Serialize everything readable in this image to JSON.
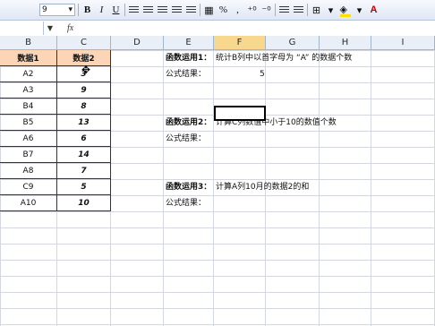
{
  "toolbar": {
    "font_size": "9",
    "bold": "B",
    "italic": "I",
    "underline": "U",
    "percent": "%",
    "comma": ",",
    "font_color": "A"
  },
  "formula_bar": {
    "fx": "fx"
  },
  "columns": [
    "B",
    "C",
    "D",
    "E",
    "F",
    "G",
    "H",
    "I"
  ],
  "active_column": "F",
  "table": {
    "headers": [
      "数据1",
      "数据2"
    ],
    "rows": [
      [
        "A2",
        "3"
      ],
      [
        "A3",
        "9"
      ],
      [
        "B4",
        "8"
      ],
      [
        "B5",
        "13"
      ],
      [
        "A6",
        "6"
      ],
      [
        "B7",
        "14"
      ],
      [
        "A8",
        "7"
      ],
      [
        "C9",
        "5"
      ],
      [
        "A10",
        "10"
      ]
    ]
  },
  "tasks": [
    {
      "label": "函数运用1：",
      "desc": "统计B列中以首字母为 “A” 的数据个数",
      "result_label": "公式结果：",
      "result": "5"
    },
    {
      "label": "函数运用2：",
      "desc": "计算C列数值中小于10的数值个数",
      "result_label": "公式结果：",
      "result": ""
    },
    {
      "label": "函数运用3：",
      "desc": "计算A列10月的数据2的和",
      "result_label": "公式结果：",
      "result": ""
    }
  ],
  "colors": {
    "header_fill": "#fbd5b5",
    "active_col": "#f8d78f"
  }
}
